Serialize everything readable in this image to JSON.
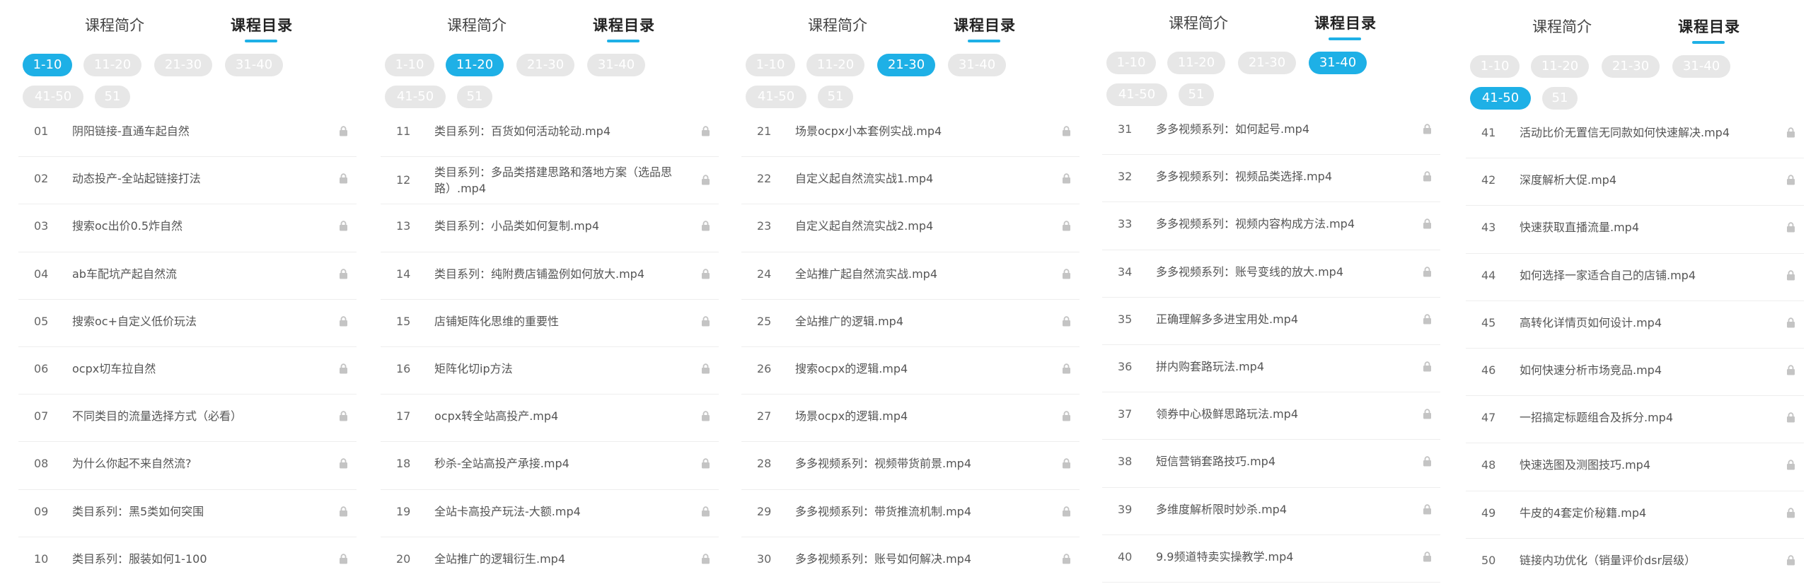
{
  "tabs": {
    "intro": "课程简介",
    "catalog": "课程目录"
  },
  "chips": [
    "1-10",
    "11-20",
    "21-30",
    "31-40",
    "41-50",
    "51"
  ],
  "lock_icon": "lock-icon",
  "colors": {
    "accent": "#1eb0e6",
    "chip_inactive": "#e7e7e7"
  },
  "panels": [
    {
      "active_chip": 0,
      "items": [
        {
          "num": "01",
          "title": "阴阳链接-直通车起自然"
        },
        {
          "num": "02",
          "title": "动态投产-全站起链接打法"
        },
        {
          "num": "03",
          "title": "搜索oc出价0.5炸自然"
        },
        {
          "num": "04",
          "title": "ab车配坑产起自然流"
        },
        {
          "num": "05",
          "title": "搜索oc+自定义低价玩法"
        },
        {
          "num": "06",
          "title": "ocpx切车拉自然"
        },
        {
          "num": "07",
          "title": "不同类目的流量选择方式（必看）"
        },
        {
          "num": "08",
          "title": "为什么你起不来自然流?"
        },
        {
          "num": "09",
          "title": "类目系列：黑5类如何突围"
        },
        {
          "num": "10",
          "title": "类目系列：服装如何1-100"
        }
      ]
    },
    {
      "active_chip": 1,
      "items": [
        {
          "num": "11",
          "title": "类目系列：百货如何活动轮动.mp4"
        },
        {
          "num": "12",
          "title": "类目系列：多品类搭建思路和落地方案（选品思路）.mp4"
        },
        {
          "num": "13",
          "title": "类目系列：小品类如何复制.mp4"
        },
        {
          "num": "14",
          "title": "类目系列：纯附费店铺盈例如何放大.mp4"
        },
        {
          "num": "15",
          "title": "店铺矩阵化思维的重要性"
        },
        {
          "num": "16",
          "title": "矩阵化切ip方法"
        },
        {
          "num": "17",
          "title": "ocpx转全站高投产.mp4"
        },
        {
          "num": "18",
          "title": "秒杀-全站高投产承接.mp4"
        },
        {
          "num": "19",
          "title": "全站卡高投产玩法-大额.mp4"
        },
        {
          "num": "20",
          "title": "全站推广的逻辑衍生.mp4"
        }
      ]
    },
    {
      "active_chip": 2,
      "items": [
        {
          "num": "21",
          "title": "场景ocpx小本套例实战.mp4"
        },
        {
          "num": "22",
          "title": "自定义起自然流实战1.mp4"
        },
        {
          "num": "23",
          "title": "自定义起自然流实战2.mp4"
        },
        {
          "num": "24",
          "title": "全站推广起自然流实战.mp4"
        },
        {
          "num": "25",
          "title": "全站推广的逻辑.mp4"
        },
        {
          "num": "26",
          "title": "搜索ocpx的逻辑.mp4"
        },
        {
          "num": "27",
          "title": "场景ocpx的逻辑.mp4"
        },
        {
          "num": "28",
          "title": "多多视频系列：视频带货前景.mp4"
        },
        {
          "num": "29",
          "title": "多多视频系列：带货推流机制.mp4"
        },
        {
          "num": "30",
          "title": "多多视频系列：账号如何解决.mp4"
        }
      ]
    },
    {
      "active_chip": 3,
      "items": [
        {
          "num": "31",
          "title": "多多视频系列：如何起号.mp4"
        },
        {
          "num": "32",
          "title": "多多视频系列：视频品类选择.mp4"
        },
        {
          "num": "33",
          "title": "多多视频系列：视频内容构成方法.mp4"
        },
        {
          "num": "34",
          "title": "多多视频系列：账号变线的放大.mp4"
        },
        {
          "num": "35",
          "title": "正确理解多多进宝用处.mp4"
        },
        {
          "num": "36",
          "title": "拼内购套路玩法.mp4"
        },
        {
          "num": "37",
          "title": "领券中心极鲜思路玩法.mp4"
        },
        {
          "num": "38",
          "title": "短信营销套路技巧.mp4"
        },
        {
          "num": "39",
          "title": "多维度解析限时妙杀.mp4"
        },
        {
          "num": "40",
          "title": "9.9频道特卖实操教学.mp4"
        }
      ]
    },
    {
      "active_chip": 4,
      "items": [
        {
          "num": "41",
          "title": "活动比价无置信无同款如何快速解决.mp4"
        },
        {
          "num": "42",
          "title": "深度解析大促.mp4"
        },
        {
          "num": "43",
          "title": "快速获取直播流量.mp4"
        },
        {
          "num": "44",
          "title": "如何选择一家适合自己的店铺.mp4"
        },
        {
          "num": "45",
          "title": "高转化详情页如何设计.mp4"
        },
        {
          "num": "46",
          "title": "如何快速分析市场竞品.mp4"
        },
        {
          "num": "47",
          "title": "一招搞定标题组合及拆分.mp4"
        },
        {
          "num": "48",
          "title": "快速选图及测图技巧.mp4"
        },
        {
          "num": "49",
          "title": "牛皮的4套定价秘籍.mp4"
        },
        {
          "num": "50",
          "title": "链接内功优化（销量评价dsr层级）"
        }
      ]
    }
  ]
}
